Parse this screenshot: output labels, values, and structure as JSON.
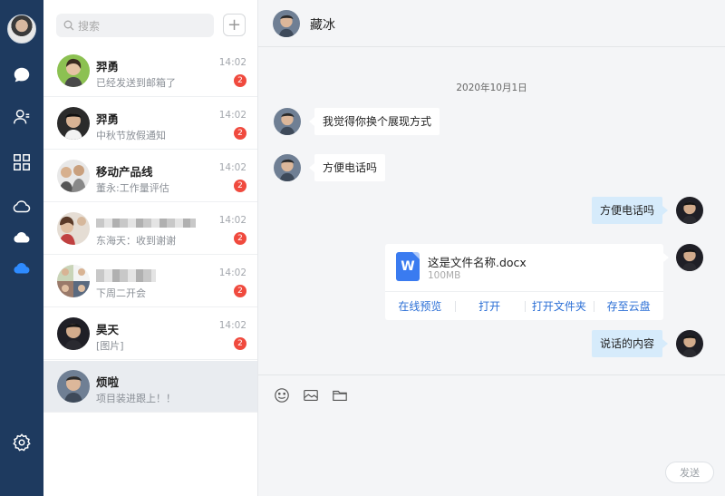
{
  "rail": {
    "items": [
      "avatar",
      "chat-icon",
      "contacts-icon",
      "apps-icon",
      "cloud-icon",
      "cloud-solid-icon",
      "cloud-active-icon",
      "settings-icon"
    ]
  },
  "search": {
    "placeholder": "搜索"
  },
  "list": {
    "conversations": [
      {
        "name": "羿勇",
        "preview": "已经发送到邮箱了",
        "time": "14:02",
        "badge": "2"
      },
      {
        "name": "羿勇",
        "preview": "中秋节放假通知",
        "time": "14:02",
        "badge": "2"
      },
      {
        "name": "移动产品线",
        "preview": "董永:工作量评估",
        "time": "14:02",
        "badge": "2"
      },
      {
        "name": "",
        "preview": "东海天：收到谢谢",
        "time": "14:02",
        "badge": "2"
      },
      {
        "name": "",
        "preview": "下周二开会",
        "time": "14:02",
        "badge": "2"
      },
      {
        "name": "昊天",
        "preview": "[图片]",
        "time": "14:02",
        "badge": "2"
      },
      {
        "name": "烦啦",
        "preview": "项目装进跟上！！",
        "time": "",
        "badge": ""
      }
    ]
  },
  "chat": {
    "title": "藏冰",
    "date": "2020年10月1日",
    "messages": [
      {
        "dir": "in",
        "text": "我觉得你换个展现方式"
      },
      {
        "dir": "in",
        "text": "方便电话吗"
      },
      {
        "dir": "out",
        "text": "方便电话吗"
      },
      {
        "dir": "out",
        "text": "说话的内容"
      }
    ],
    "file": {
      "icon_letter": "W",
      "name": "这是文件名称.docx",
      "size": "100MB",
      "actions": [
        "在线预览",
        "打开",
        "打开文件夹",
        "存至云盘"
      ]
    },
    "send_label": "发送"
  },
  "colors": {
    "rail": "#1e3a5f",
    "accent": "#2b6fd6",
    "badge": "#f04a3e",
    "out_bubble": "#d6ebfb"
  }
}
